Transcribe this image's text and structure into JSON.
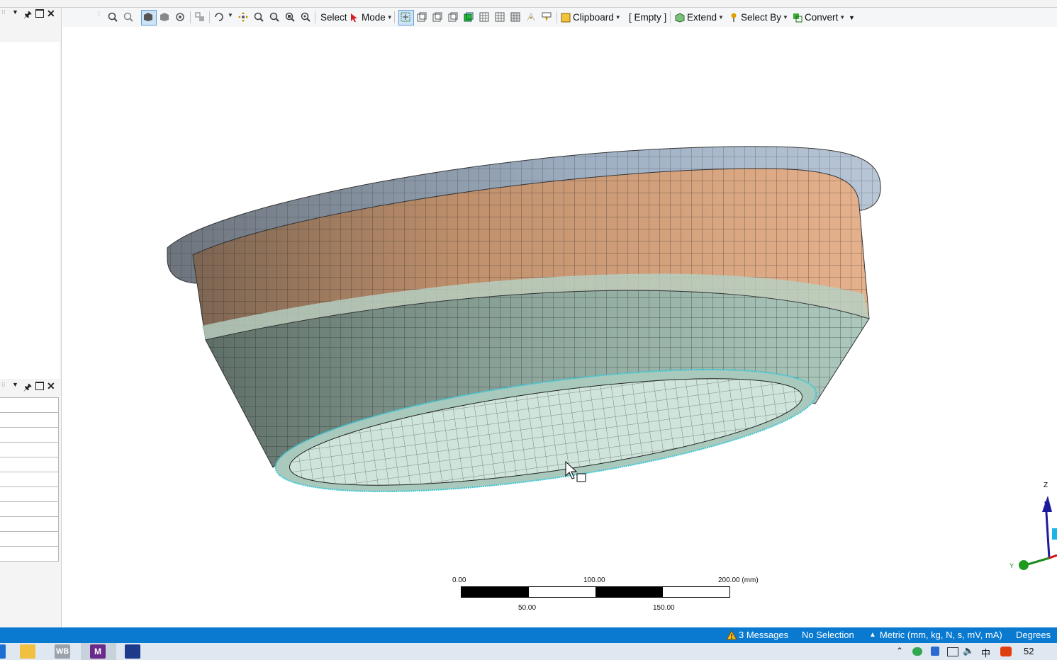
{
  "toolbar": {
    "select_label": "Select",
    "mode_label": "Mode",
    "clipboard_label": "Clipboard",
    "clipboard_value": "[ Empty ]",
    "extend_label": "Extend",
    "select_by_label": "Select By",
    "convert_label": "Convert"
  },
  "viewport": {
    "scale_top_labels": [
      "0.00",
      "100.00",
      "200.00 (mm)"
    ],
    "scale_bottom_labels": [
      "50.00",
      "150.00"
    ],
    "axis_labels": {
      "z": "Z",
      "y": "Y"
    },
    "colors": {
      "body": "#dba27c",
      "bottom": "#a4c6b9",
      "rim": "#a9b8c9",
      "mesh_line": "#1a1a1a"
    }
  },
  "status": {
    "messages": "3 Messages",
    "selection": "No Selection",
    "units": "Metric (mm, kg, N, s, mV, mA)",
    "angle": "Degrees"
  },
  "taskbar": {
    "wb_label": "WB",
    "m_label": "M",
    "ime_label": "中",
    "clock_label": "52"
  }
}
